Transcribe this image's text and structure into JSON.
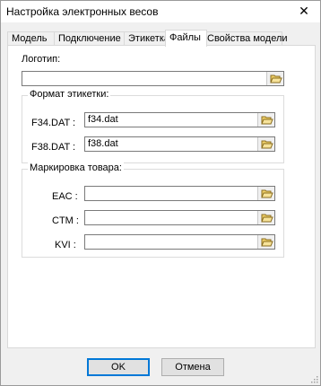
{
  "window": {
    "title": "Настройка электронных весов",
    "close_glyph": "✕"
  },
  "tabs": [
    {
      "label": "Модель"
    },
    {
      "label": "Подключение"
    },
    {
      "label": "Этикетка"
    },
    {
      "label": "Файлы",
      "active": true
    },
    {
      "label": "Свойства модели"
    }
  ],
  "logo": {
    "label": "Логотип:",
    "value": ""
  },
  "label_format": {
    "title": "Формат этикетки:",
    "rows": [
      {
        "label": "F34.DAT :",
        "value": "f34.dat"
      },
      {
        "label": "F38.DAT :",
        "value": "f38.dat"
      }
    ]
  },
  "marking": {
    "title": "Маркировка товара:",
    "rows": [
      {
        "label": "EAC :",
        "value": ""
      },
      {
        "label": "CTM :",
        "value": ""
      },
      {
        "label": "KVI :",
        "value": ""
      }
    ]
  },
  "buttons": {
    "ok": "OK",
    "cancel": "Отмена"
  },
  "icons": {
    "browse": "folder-open-icon"
  }
}
